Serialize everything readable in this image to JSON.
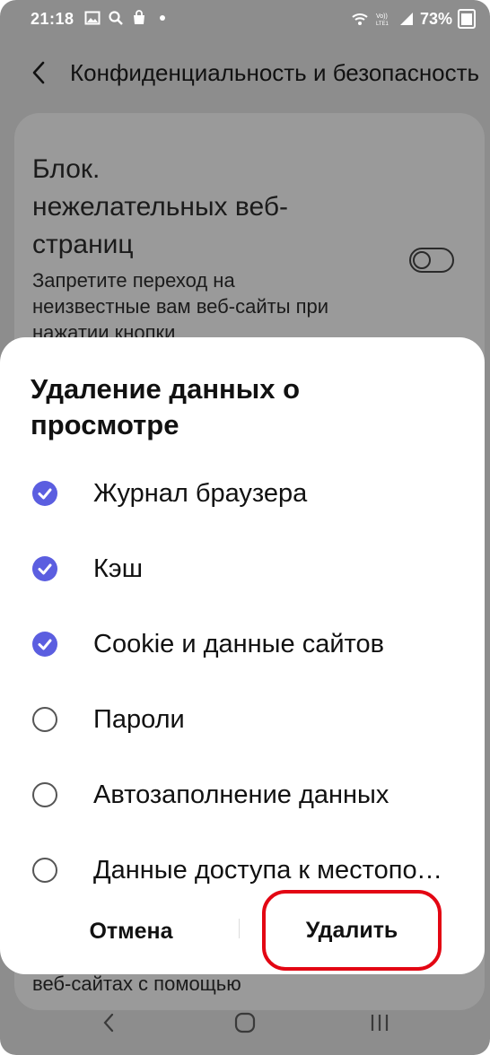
{
  "status_bar": {
    "time": "21:18",
    "battery": "73%",
    "left_icons": [
      "image-icon",
      "search-icon",
      "shopping-bag-icon",
      "dot-icon"
    ],
    "right_icons": [
      "wifi-icon",
      "volte-icon",
      "signal-icon",
      "battery-icon"
    ],
    "volte_text": "Vo))\nLTE1"
  },
  "header": {
    "title": "Конфиденциальность и безопасность"
  },
  "background": {
    "setting_title": "Блок. нежелательных веб-страниц",
    "setting_desc": "Запретите переход на неизвестные вам веб-сайты при нажатии кнопки",
    "toggle_on": false,
    "bottom_text": "веб-сайтах с помощью"
  },
  "dialog": {
    "title": "Удаление данных о просмотре",
    "options": [
      {
        "label": "Журнал браузера",
        "checked": true
      },
      {
        "label": "Кэш",
        "checked": true
      },
      {
        "label": "Cookie и данные сайтов",
        "checked": true
      },
      {
        "label": "Пароли",
        "checked": false
      },
      {
        "label": "Автозаполнение данных",
        "checked": false
      },
      {
        "label": "Данные доступа к местоположению",
        "checked": false
      }
    ],
    "cancel_label": "Отмена",
    "delete_label": "Удалить"
  },
  "colors": {
    "accent": "#5b5ee0",
    "highlight": "#e30613"
  }
}
